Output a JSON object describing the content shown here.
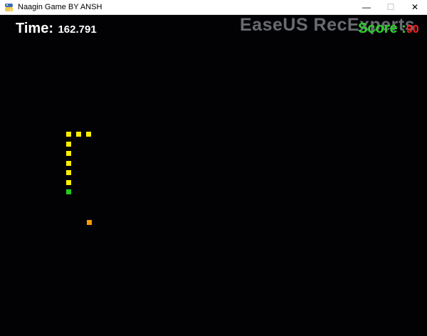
{
  "window": {
    "title": "Naagin Game BY ANSH",
    "minimize_glyph": "—",
    "maximize_glyph": "☐",
    "close_glyph": "✕"
  },
  "hud": {
    "time_label": "Time:",
    "time_value": "162.791",
    "score_label": "Score :",
    "score_value": "90"
  },
  "watermark": "EaseUS RecExperts",
  "colors": {
    "snake_body": "#ffee00",
    "snake_head": "#22cc22",
    "food": "#ff9900",
    "background": "#020205"
  },
  "snake": {
    "head_icon": "snake-head-square",
    "body_icon": "snake-body-square",
    "segment_count": 9
  },
  "food": {
    "icon": "food-square"
  }
}
